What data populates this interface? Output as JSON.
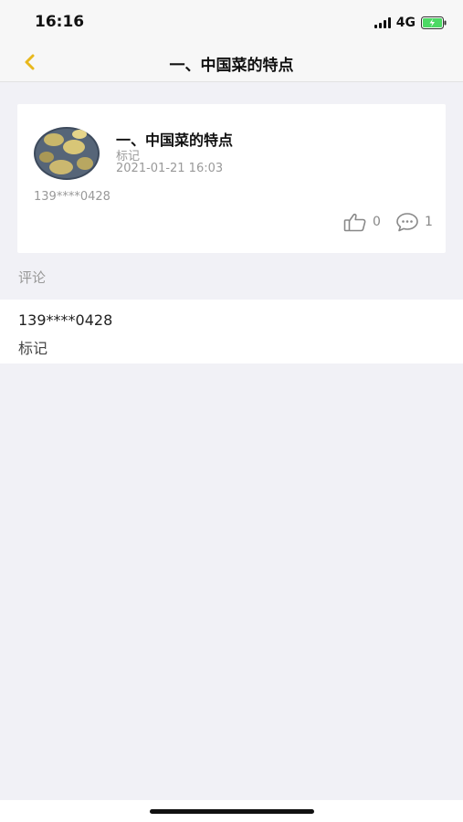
{
  "status_bar": {
    "time": "16:16",
    "network": "4G",
    "battery_color": "#4cd964"
  },
  "nav": {
    "title": "一、中国菜的特点",
    "back_icon": "chevron-left-icon",
    "accent_color": "#e8b81c"
  },
  "post": {
    "title": "一、中国菜的特点",
    "tag": "标记",
    "time": "2021-01-21 16:03",
    "user": "139****0428",
    "likes": "0",
    "comments": "1",
    "like_icon": "thumbs-up-icon",
    "comment_icon": "speech-bubble-icon"
  },
  "comments_section": {
    "label": "评论",
    "items": [
      {
        "user": "139****0428",
        "text": "标记"
      }
    ]
  }
}
